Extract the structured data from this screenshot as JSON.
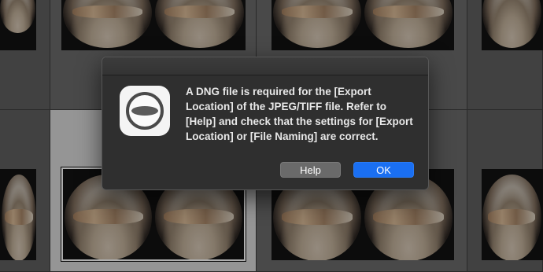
{
  "dialog": {
    "message": "A DNG file is required for the [Export Location] of the JPEG/TIFF file. Refer to [Help] and check that the settings for [Export Location] or [File Naming] are correct.",
    "help_label": "Help",
    "ok_label": "OK",
    "icon": "app-icon"
  },
  "colors": {
    "ok_button": "#1a6ff2",
    "help_button": "#6a6a6a",
    "dialog_bg": "#2f2f2f"
  }
}
